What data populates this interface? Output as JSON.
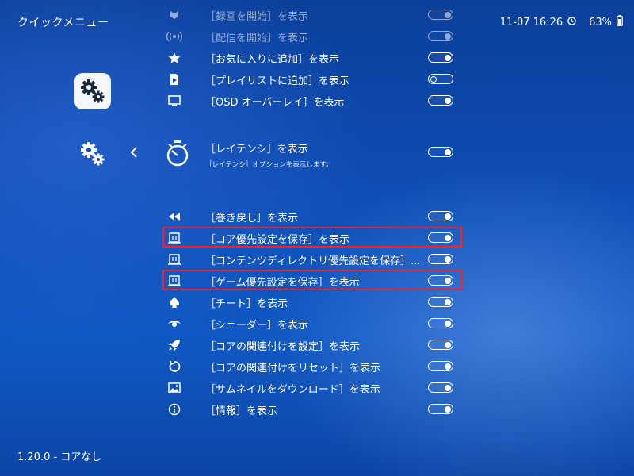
{
  "header": {
    "title": "クイックメニュー",
    "time": "11-07 16:26",
    "battery": "63%"
  },
  "footer": {
    "version": "1.20.0 - コアなし"
  },
  "icons": {
    "app": "settings-gears-icon",
    "side": "settings-gears-icon",
    "back": "chevron-left-icon",
    "clock": "clock-icon",
    "battery": "battery-icon"
  },
  "top_items": [
    {
      "label": "［録画を開始］を表示",
      "icon": "record-icon",
      "toggle": "on"
    },
    {
      "label": "［配信を開始］を表示",
      "icon": "stream-icon",
      "toggle": "on"
    },
    {
      "label": "［お気に入りに追加］を表示",
      "icon": "star-icon",
      "toggle": "on"
    },
    {
      "label": "［プレイリストに追加］を表示",
      "icon": "playlist-icon",
      "toggle": "off"
    },
    {
      "label": "［OSD オーバーレイ］を表示",
      "icon": "monitor-icon",
      "toggle": "on"
    }
  ],
  "selected_item": {
    "label": "［レイテンシ］を表示",
    "sublabel": "［レイテンシ］オプションを表示します。",
    "icon": "timer-icon",
    "toggle": "on"
  },
  "bottom_items": [
    {
      "label": "［巻き戻し］を表示",
      "icon": "rewind-icon",
      "toggle": "on"
    },
    {
      "label": "［コア優先設定を保存］を表示",
      "icon": "save-book-icon",
      "toggle": "on",
      "highlighted": true
    },
    {
      "label": "［コンテンツディレクトリ優先設定を保存］...",
      "icon": "save-book-icon",
      "toggle": "on"
    },
    {
      "label": "［ゲーム優先設定を保存］を表示",
      "icon": "save-book-icon",
      "toggle": "on",
      "highlighted": true
    },
    {
      "label": "［チート］を表示",
      "icon": "spade-icon",
      "toggle": "on"
    },
    {
      "label": "［シェーダー］を表示",
      "icon": "eye-icon",
      "toggle": "on"
    },
    {
      "label": "［コアの関連付けを設定］を表示",
      "icon": "rocket-icon",
      "toggle": "on"
    },
    {
      "label": "［コアの関連付けをリセット］を表示",
      "icon": "reset-icon",
      "toggle": "on"
    },
    {
      "label": "［サムネイルをダウンロード］を表示",
      "icon": "image-icon",
      "toggle": "on"
    },
    {
      "label": "［情報］を表示",
      "icon": "info-icon",
      "toggle": "on"
    }
  ],
  "colors": {
    "highlight": "#ff1e1e",
    "background": "#0e4fb7"
  }
}
